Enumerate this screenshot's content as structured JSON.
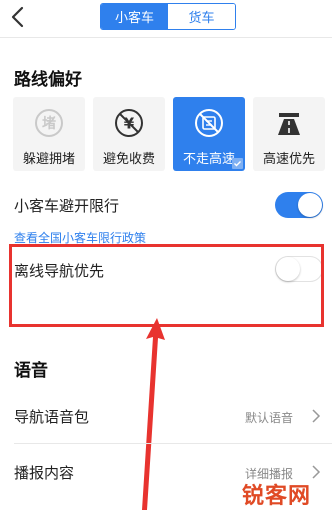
{
  "header": {
    "back_icon": "chevron-left-icon",
    "tabs": [
      {
        "label": "小客车",
        "active": true
      },
      {
        "label": "货车",
        "active": false
      }
    ],
    "accent_color": "#2f80ed"
  },
  "route_pref": {
    "title": "路线偏好",
    "options": [
      {
        "label": "躲避拥堵",
        "icon": "congestion-avoid-icon",
        "selected": false
      },
      {
        "label": "避免收费",
        "icon": "no-toll-icon",
        "selected": false
      },
      {
        "label": "不走高速",
        "icon": "no-highway-icon",
        "selected": true
      },
      {
        "label": "高速优先",
        "icon": "highway-icon",
        "selected": false
      }
    ]
  },
  "restriction": {
    "label": "小客车避开限行",
    "enabled": true,
    "policy_link": "查看全国小客车限行政策"
  },
  "offline": {
    "label": "离线导航优先",
    "enabled": false
  },
  "voice": {
    "title": "语音",
    "items": [
      {
        "label": "导航语音包",
        "value": "默认语音"
      },
      {
        "label": "播报内容",
        "value": "详细播报"
      }
    ]
  },
  "watermark": {
    "text": "锐客网"
  }
}
